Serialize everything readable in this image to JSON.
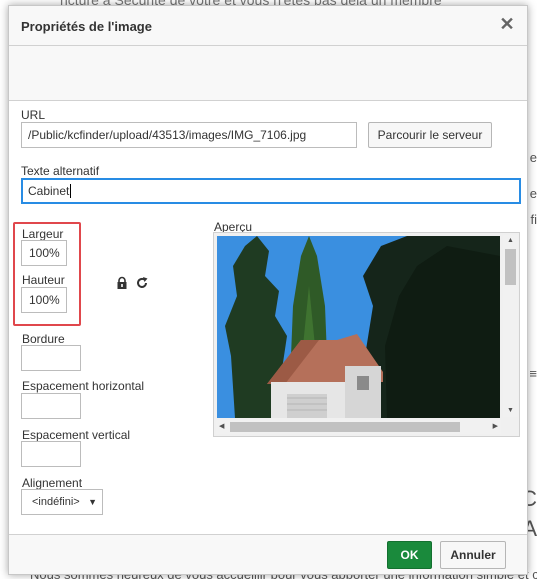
{
  "background": {
    "top_text": "ncture à Sécurité de votre et vous n'êtes pas déjà un membre",
    "bottom_text": "Nous sommes heureux de vous accueillir pour vous apporter une information simple et c",
    "right_fragments": [
      "e",
      "e",
      "fi",
      "≡",
      "C",
      "A"
    ]
  },
  "dialog": {
    "title": "Propriétés de l'image",
    "close_symbol": "✕",
    "url": {
      "label": "URL",
      "value": "/Public/kcfinder/upload/43513/images/IMG_7106.jpg",
      "browse_label": "Parcourir le serveur"
    },
    "alt": {
      "label": "Texte alternatif",
      "value": "Cabinet"
    },
    "width": {
      "label": "Largeur",
      "value": "100%"
    },
    "height": {
      "label": "Hauteur",
      "value": "100%"
    },
    "border": {
      "label": "Bordure",
      "value": ""
    },
    "hspace": {
      "label": "Espacement horizontal",
      "value": ""
    },
    "vspace": {
      "label": "Espacement vertical",
      "value": ""
    },
    "align": {
      "label": "Alignement",
      "selected": "<indéfini>"
    },
    "preview": {
      "label": "Aperçu"
    },
    "ok_label": "OK",
    "cancel_label": "Annuler"
  },
  "colors": {
    "ok_button": "#1a8a3c",
    "focus_border": "#288ce4",
    "highlight": "#e0474c",
    "sky": "#3a8fe0"
  }
}
